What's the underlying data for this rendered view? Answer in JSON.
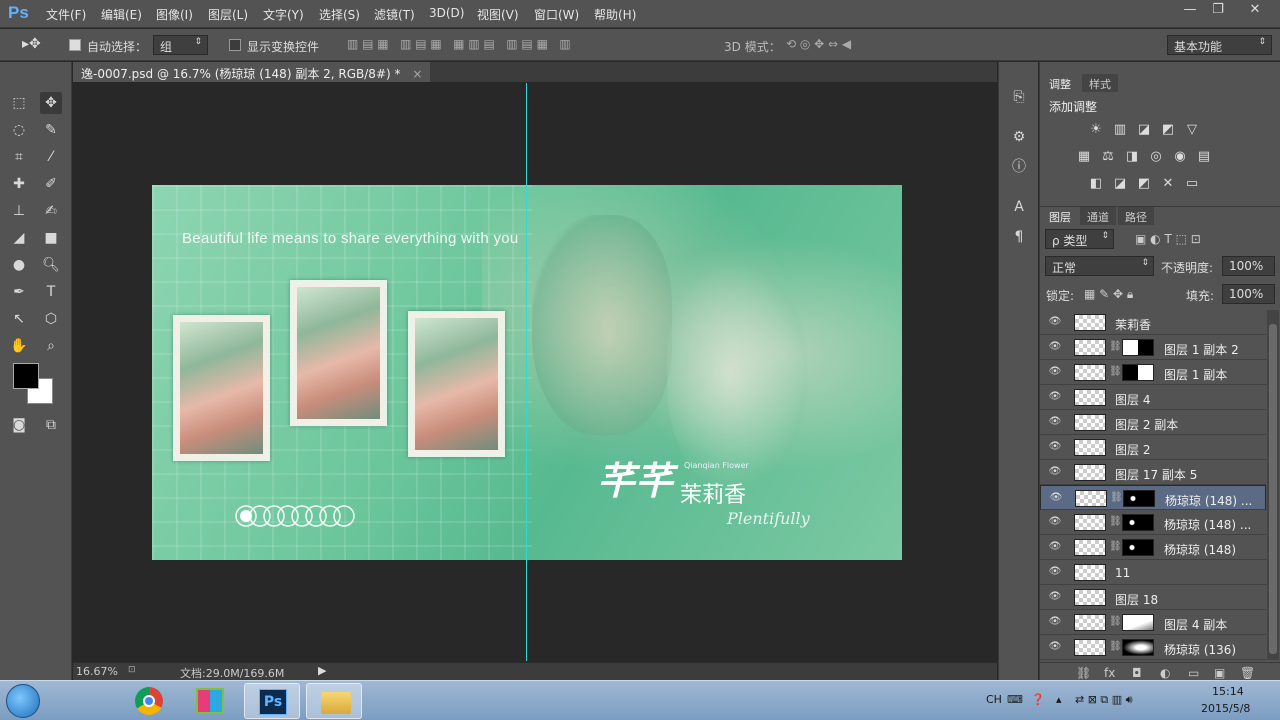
{
  "app": {
    "logo": "Ps"
  },
  "menu": {
    "items": [
      "文件(F)",
      "编辑(E)",
      "图像(I)",
      "图层(L)",
      "文字(Y)",
      "选择(S)",
      "滤镜(T)",
      "3D(D)",
      "视图(V)",
      "窗口(W)",
      "帮助(H)"
    ]
  },
  "window": {
    "min": "—",
    "restore": "❐",
    "close": "✕"
  },
  "options": {
    "auto_select_label": "自动选择：",
    "auto_select_value": "组",
    "show_transform_label": "显示变换控件",
    "mode3d_label": "3D 模式：",
    "workspace": "基本功能"
  },
  "document": {
    "tab_title": "逸-0007.psd @ 16.7% (杨琼琼 (148) 副本 2, RGB/8#) *",
    "tab_close": "×"
  },
  "artwork": {
    "tagline": "Beautiful life means to share everything with you",
    "logo_main": "芊芊",
    "logo_name": "茉莉香",
    "logo_sub": "Plentifully",
    "logo_small": "Qianqian Flower"
  },
  "status": {
    "zoom": "16.67%",
    "doc": "文档:29.0M/169.6M"
  },
  "adjust": {
    "tab_adjust": "调整",
    "tab_style": "样式",
    "title": "添加调整",
    "icons_row1": [
      "☀",
      "▥",
      "◪",
      "◩",
      "▽"
    ],
    "icons_row2": [
      "▦",
      "⚖",
      "◨",
      "◎",
      "◉",
      "▤"
    ],
    "icons_row3": [
      "◧",
      "◪",
      "◩",
      "✕",
      "▭"
    ]
  },
  "layers_panel": {
    "tab_layers": "图层",
    "tab_channels": "通道",
    "tab_paths": "路径",
    "filter_label": "ρ 类型",
    "blend_mode": "正常",
    "opacity_label": "不透明度:",
    "opacity_value": "100%",
    "lock_label": "锁定:",
    "fill_label": "填充:",
    "fill_value": "100%",
    "layers": [
      {
        "name": "茉莉香",
        "mask": "none"
      },
      {
        "name": "图层 1 副本 2",
        "mask": "white-black"
      },
      {
        "name": "图层 1 副本",
        "mask": "black-white"
      },
      {
        "name": "图层 4",
        "mask": "none"
      },
      {
        "name": "图层 2 副本",
        "mask": "none"
      },
      {
        "name": "图层 2",
        "mask": "none"
      },
      {
        "name": "图层 17 副本 5",
        "mask": "none"
      },
      {
        "name": "杨琼琼 (148) ...",
        "mask": "black-dot",
        "selected": true
      },
      {
        "name": "杨琼琼 (148) ...",
        "mask": "black-dot"
      },
      {
        "name": "杨琼琼 (148)",
        "mask": "black-dot"
      },
      {
        "name": "11",
        "mask": "none"
      },
      {
        "name": "图层 18",
        "mask": "none"
      },
      {
        "name": "图层 4 副本",
        "mask": "white-gray"
      },
      {
        "name": "杨琼琼 (136)",
        "mask": "black-white-soft"
      }
    ]
  },
  "panel_footer": {
    "icons": [
      "⛓",
      "fx",
      "◘",
      "◐",
      "▭",
      "▣",
      "🗑"
    ]
  },
  "taskbar": {
    "time": "15:14",
    "date": "2015/5/8",
    "lang": "CH"
  },
  "colors": {
    "accent": "#5fb3ff",
    "guide": "#35d6d6",
    "selected_row": "#5c6b85"
  }
}
